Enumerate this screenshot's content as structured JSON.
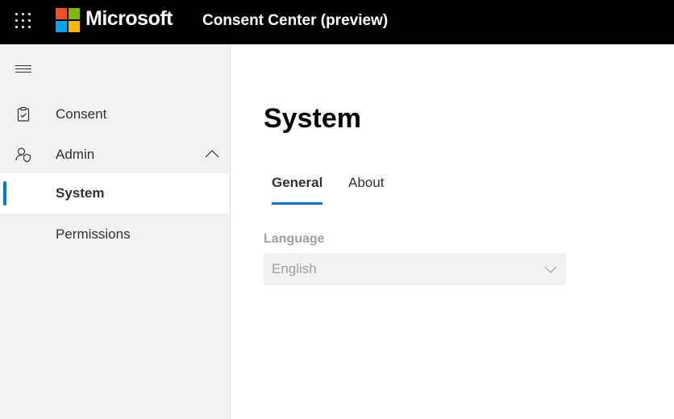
{
  "header": {
    "brand": "Microsoft",
    "app_title": "Consent Center (preview)",
    "logo_colors": [
      "#f25022",
      "#7fba00",
      "#00a4ef",
      "#ffb900"
    ],
    "waffle_icon": "waffle-icon"
  },
  "sidebar": {
    "toggle_icon": "hamburger-icon",
    "items": [
      {
        "label": "Consent",
        "icon": "clipboard-check-icon"
      },
      {
        "label": "Admin",
        "icon": "person-shield-icon",
        "expanded": true
      },
      {
        "label": "System",
        "selected": true
      },
      {
        "label": "Permissions"
      }
    ]
  },
  "main": {
    "title": "System",
    "tabs": [
      {
        "label": "General",
        "active": true
      },
      {
        "label": "About"
      }
    ],
    "language": {
      "label": "Language",
      "value": "English",
      "disabled": true
    }
  },
  "colors": {
    "accent": "#0078d4",
    "topbar": "#000000",
    "sidebar_bg": "#f3f2f1"
  }
}
